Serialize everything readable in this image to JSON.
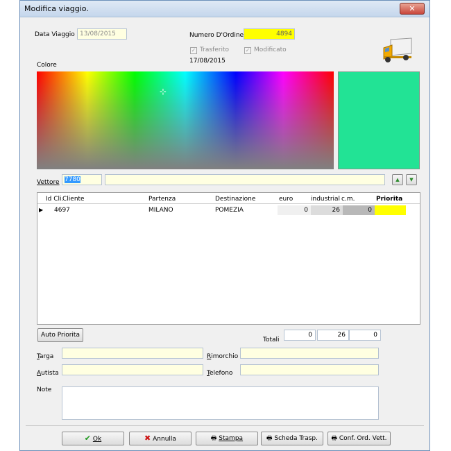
{
  "window": {
    "title": "Modifica viaggio.",
    "close_glyph": "✕"
  },
  "form": {
    "data_viaggio_label": "Data Viaggio",
    "data_viaggio_value": "13/08/2015",
    "numero_ordine_label": "Numero D'Ordine",
    "numero_ordine_value": "4894",
    "trasferito_label": "Trasferito",
    "modificato_label": "Modificato",
    "date_text": "17/08/2015",
    "colore_label": "Colore",
    "vettore_label": "Vettore",
    "vettore_code": "7780",
    "vettore_name": ""
  },
  "colors": {
    "preview": "#22e395",
    "ordine_bg": "#ffff00",
    "priorita_bg": "#ffff00"
  },
  "table": {
    "columns": [
      "Id Cli.",
      "Cliente",
      "Partenza",
      "Destinazione",
      "euro",
      "industrial",
      "c.m.",
      "Priorita"
    ],
    "rows": [
      {
        "id": "4697",
        "cliente": "",
        "partenza": "MILANO",
        "destinazione": "POMEZIA",
        "euro": "0",
        "industrial": "26",
        "cm": "0",
        "priorita": ""
      }
    ]
  },
  "footer": {
    "auto_priorita": "Auto Priorita",
    "totali_label": "Totali",
    "totali": [
      "0",
      "26",
      "0"
    ],
    "targa_label": "Targa",
    "rimorchio_label": "Rimorchio",
    "autista_label": "Autista",
    "telefono_label": "Telefono",
    "note_label": "Note"
  },
  "buttons": {
    "ok": "Ok",
    "annulla": "Annulla",
    "stampa": "Stampa",
    "scheda": "Scheda Trasp.",
    "conf": "Conf. Ord. Vett."
  },
  "icons": {
    "up": "▲",
    "down": "▼",
    "row_pointer": "▶",
    "check": "✓",
    "ok": "✔",
    "cancel": "✖",
    "printer": "🖶"
  }
}
